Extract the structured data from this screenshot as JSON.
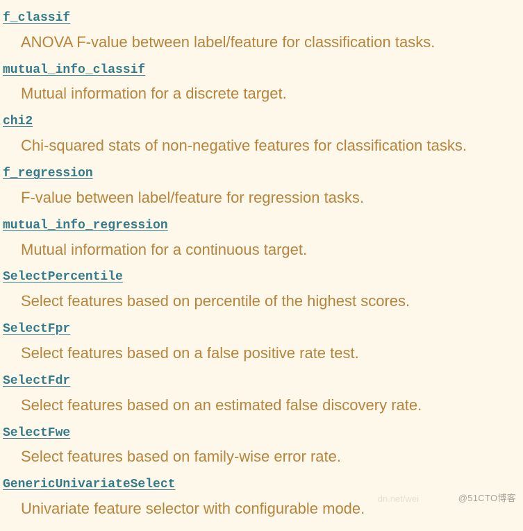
{
  "entries": [
    {
      "term": "f_classif",
      "desc": "ANOVA F-value between label/feature for classification tasks."
    },
    {
      "term": "mutual_info_classif",
      "desc": "Mutual information for a discrete target."
    },
    {
      "term": "chi2",
      "desc": "Chi-squared stats of non-negative features for classification tasks."
    },
    {
      "term": "f_regression",
      "desc": "F-value between label/feature for regression tasks."
    },
    {
      "term": "mutual_info_regression",
      "desc": "Mutual information for a continuous target."
    },
    {
      "term": "SelectPercentile",
      "desc": "Select features based on percentile of the highest scores."
    },
    {
      "term": "SelectFpr",
      "desc": "Select features based on a false positive rate test."
    },
    {
      "term": "SelectFdr",
      "desc": "Select features based on an estimated false discovery rate."
    },
    {
      "term": "SelectFwe",
      "desc": "Select features based on family-wise error rate."
    },
    {
      "term": "GenericUnivariateSelect",
      "desc": "Univariate feature selector with configurable mode."
    }
  ],
  "watermark": "@51CTO博客",
  "watermark_faint": "dn.net/wei"
}
